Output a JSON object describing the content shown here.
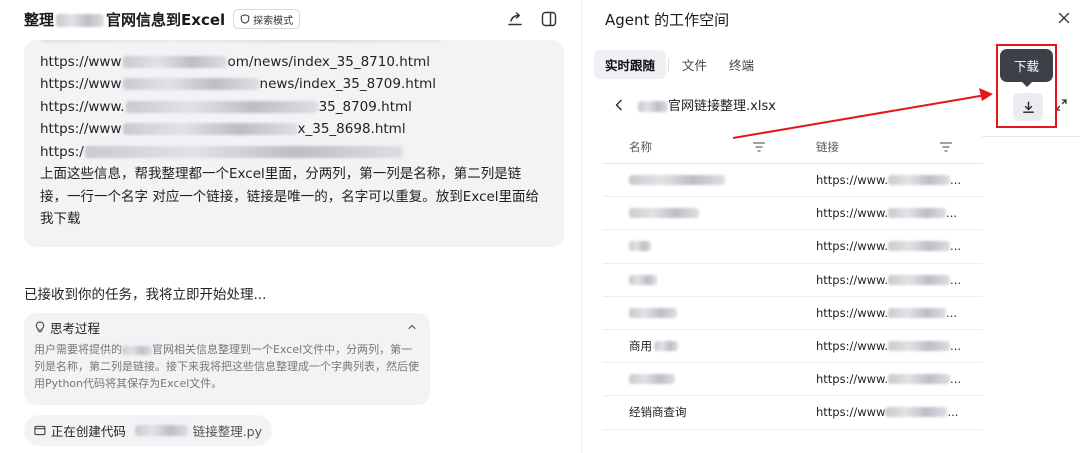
{
  "chat": {
    "title_prefix": "整理",
    "title_suffix": "官网信息到Excel",
    "mode_badge": "探索模式",
    "url_lines": [
      {
        "start": "https://www",
        "end": "om/news/index_35_8710.html"
      },
      {
        "start": "https://www",
        "end": "news/index_35_8709.html"
      },
      {
        "start": "https://www.",
        "end": "35_8709.html"
      },
      {
        "start": "https://www",
        "end": "x_35_8698.html"
      },
      {
        "start": "https:/",
        "end": ""
      }
    ],
    "request_text": "上面这些信息，帮我整理都一个Excel里面，分两列，第一列是名称，第二列是链接，一行一个名字 对应一个链接，链接是唯一的，名字可以重复。放到Excel里面给我下载",
    "ack_text": "已接收到你的任务，我将立即开始处理...",
    "thinking": {
      "label": "思考过程",
      "body_before": "用户需要将提供的",
      "body_after": "官网相关信息整理到一个Excel文件中，分两列，第一列是名称，第二列是链接。接下来我将把这些信息整理成一个字典列表，然后使用Python代码将其保存为Excel文件。"
    },
    "code_chip": {
      "label": "正在创建代码",
      "file_suffix": "链接整理.py"
    }
  },
  "workspace": {
    "title": "Agent 的工作空间",
    "tabs": [
      "实时跟随",
      "文件",
      "终端"
    ],
    "file_name_suffix": "官网链接整理.xlsx",
    "tooltip": "下载",
    "columns": [
      "名称",
      "链接"
    ],
    "rows": [
      {
        "name": "",
        "link": "https://www."
      },
      {
        "name": "",
        "link": "https://www."
      },
      {
        "name": "",
        "link": "https://www."
      },
      {
        "name": "",
        "link": "https://www."
      },
      {
        "name": "",
        "link": "https://www."
      },
      {
        "name": "商用",
        "link": "https://www."
      },
      {
        "name": "",
        "link": "https://www."
      },
      {
        "name": "经销商查询",
        "link": "https://www"
      }
    ],
    "ellipsis": "..."
  },
  "icons": [
    "share-icon",
    "panel-toggle-icon",
    "close-icon",
    "back-icon",
    "download-icon",
    "expand-icon",
    "filter-icon",
    "lightbulb-icon",
    "chevron-up-icon",
    "shield-icon",
    "window-icon"
  ],
  "colors": {
    "annotation_red": "#e4161b",
    "tooltip_bg": "#3d4048"
  }
}
